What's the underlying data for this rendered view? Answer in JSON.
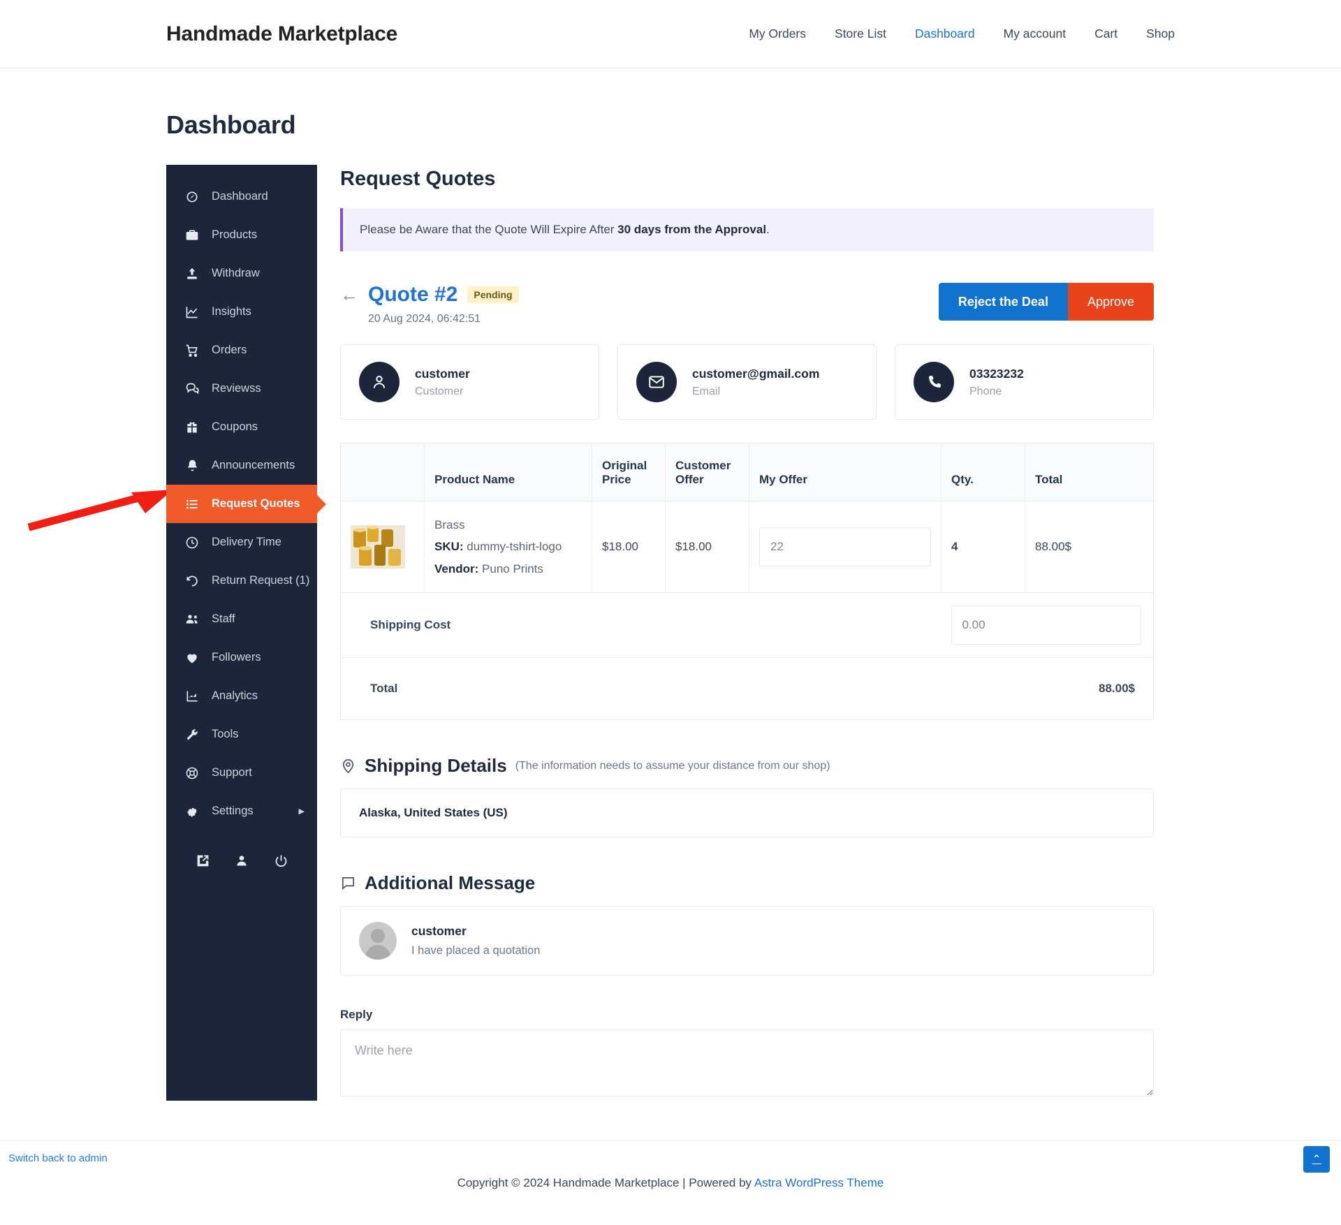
{
  "header": {
    "brand": "Handmade Marketplace",
    "nav": [
      {
        "label": "My Orders",
        "active": false
      },
      {
        "label": "Store List",
        "active": false
      },
      {
        "label": "Dashboard",
        "active": true
      },
      {
        "label": "My account",
        "active": false
      },
      {
        "label": "Cart",
        "active": false
      },
      {
        "label": "Shop",
        "active": false
      }
    ]
  },
  "page": {
    "title": "Dashboard"
  },
  "sidebar": {
    "items": [
      {
        "label": "Dashboard",
        "icon": "speedometer-icon"
      },
      {
        "label": "Products",
        "icon": "briefcase-icon"
      },
      {
        "label": "Withdraw",
        "icon": "upload-icon"
      },
      {
        "label": "Insights",
        "icon": "chart-line-icon"
      },
      {
        "label": "Orders",
        "icon": "shopping-cart-icon"
      },
      {
        "label": "Reviewss",
        "icon": "comments-icon"
      },
      {
        "label": "Coupons",
        "icon": "gift-icon"
      },
      {
        "label": "Announcements",
        "icon": "bell-icon"
      },
      {
        "label": "Request Quotes",
        "icon": "list-icon",
        "active": true
      },
      {
        "label": "Delivery Time",
        "icon": "clock-icon"
      },
      {
        "label": "Return Request (1)",
        "icon": "undo-icon"
      },
      {
        "label": "Staff",
        "icon": "users-icon"
      },
      {
        "label": "Followers",
        "icon": "heart-icon"
      },
      {
        "label": "Analytics",
        "icon": "analytics-icon"
      },
      {
        "label": "Tools",
        "icon": "wrench-icon"
      },
      {
        "label": "Support",
        "icon": "lifebuoy-icon"
      },
      {
        "label": "Settings",
        "icon": "gear-icon",
        "caret": "▶"
      }
    ],
    "bottom_icons": [
      "external-link-icon",
      "user-icon",
      "power-icon"
    ]
  },
  "main": {
    "title": "Request Quotes",
    "notice_text_before": "Please be Aware that the Quote Will Expire After ",
    "notice_text_bold": "30 days from the Approval",
    "notice_text_after": ".",
    "back_arrow": "←",
    "quote_id": "Quote #2",
    "status_badge": "Pending",
    "date": "20 Aug 2024, 06:42:51",
    "reject_label": "Reject the Deal",
    "approve_label": "Approve",
    "info_cards": [
      {
        "icon": "user-icon",
        "main": "customer",
        "sub": "Customer"
      },
      {
        "icon": "envelope-icon",
        "main": "customer@gmail.com",
        "sub": "Email"
      },
      {
        "icon": "phone-icon",
        "main": "03323232",
        "sub": "Phone"
      }
    ],
    "table": {
      "headers": [
        "",
        "Product Name",
        "Original Price",
        "Customer Offer",
        "My Offer",
        "Qty.",
        "Total"
      ],
      "row": {
        "product_title": "Brass",
        "sku_label": "SKU:",
        "sku_value": " dummy-tshirt-logo",
        "vendor_label": "Vendor:",
        "vendor_value": " Puno Prints",
        "original_price": "$18.00",
        "customer_offer": "$18.00",
        "my_offer_value": "22",
        "qty": "4",
        "total": "88.00$"
      },
      "shipping_label": "Shipping Cost",
      "shipping_value": "0.00",
      "total_label": "Total",
      "total_value": "88.00$"
    },
    "shipping": {
      "icon": "map-pin-icon",
      "title": "Shipping Details",
      "note": "(The information needs to assume your distance from our shop)",
      "address": "Alaska, United States (US)"
    },
    "message": {
      "icon": "chat-icon",
      "title": "Additional Message",
      "author": "customer",
      "text": "I have placed a quotation",
      "reply_label": "Reply",
      "reply_placeholder": "Write here"
    }
  },
  "footer": {
    "switch_admin": "Switch back to admin",
    "copyright_before": "Copyright © 2024 Handmade Marketplace | Powered by ",
    "copyright_link": "Astra WordPress Theme",
    "back_to_top": "⌃"
  },
  "colors": {
    "accent_orange": "#f15a29",
    "primary_blue": "#1273cf",
    "approve_red": "#e8431a",
    "sidebar_bg": "#1c2539",
    "notice_bg": "#f3f1fd",
    "notice_border": "#7b4bf0",
    "badge_bg": "#fdf2c8"
  }
}
